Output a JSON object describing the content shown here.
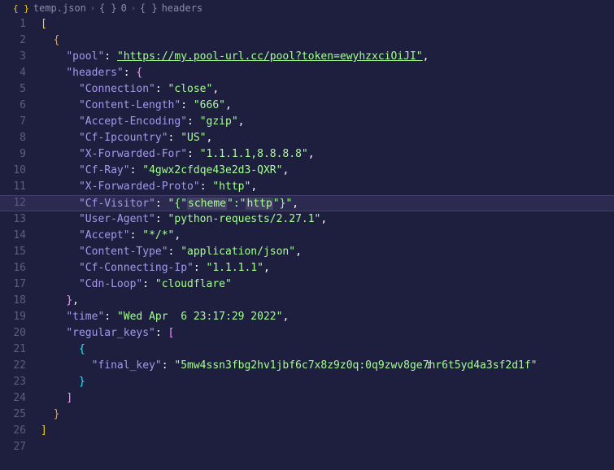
{
  "breadcrumb": {
    "filename": "temp.json",
    "path1": "0",
    "path2": "headers"
  },
  "lines": {
    "total": 27,
    "active": 12
  },
  "code": {
    "l1": "[",
    "l2_brace": "{",
    "l3_key": "\"pool\"",
    "l3_val": "\"https://my.pool-url.cc/pool?token=ewyhzxciOiJI\"",
    "l4_key": "\"headers\"",
    "l4_brace": "{",
    "l5_key": "\"Connection\"",
    "l5_val": "\"close\"",
    "l6_key": "\"Content-Length\"",
    "l6_val": "\"666\"",
    "l7_key": "\"Accept-Encoding\"",
    "l7_val": "\"gzip\"",
    "l8_key": "\"Cf-Ipcountry\"",
    "l8_val": "\"US\"",
    "l9_key": "\"X-Forwarded-For\"",
    "l9_val": "\"1.1.1.1,8.8.8.8\"",
    "l10_key": "\"Cf-Ray\"",
    "l10_val": "\"4gwx2cfdqe43e2d3-QXR\"",
    "l11_key": "\"X-Forwarded-Proto\"",
    "l11_val": "\"http\"",
    "l12_key": "\"Cf-Visitor\"",
    "l12_val_a": "\"{\"",
    "l12_val_b": "scheme",
    "l12_val_c": "\":\"",
    "l12_val_d": "http",
    "l12_val_e": "\"}\"",
    "l13_key": "\"User-Agent\"",
    "l13_val": "\"python-requests/2.27.1\"",
    "l14_key": "\"Accept\"",
    "l14_val": "\"*/*\"",
    "l15_key": "\"Content-Type\"",
    "l15_val": "\"application/json\"",
    "l16_key": "\"Cf-Connecting-Ip\"",
    "l16_val": "\"1.1.1.1\"",
    "l17_key": "\"Cdn-Loop\"",
    "l17_val": "\"cloudflare\"",
    "l18_brace": "}",
    "l19_key": "\"time\"",
    "l19_val": "\"Wed Apr  6 23:17:29 2022\"",
    "l20_key": "\"regular_keys\"",
    "l20_brace": "[",
    "l21_brace": "{",
    "l22_key": "\"final_key\"",
    "l22_val": "\"5mw4ssn3fbg2hv1jbf6c7x8z9z0q:0q9zwv8ge7hr6t5yd4a3sf2d1f\"",
    "l23_brace": "}",
    "l24_brace": "]",
    "l25_brace": "}",
    "l26_brace": "]"
  }
}
